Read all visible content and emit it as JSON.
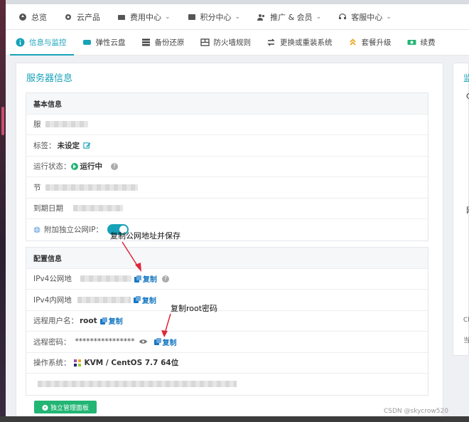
{
  "topnav": {
    "items": [
      {
        "label": "总览",
        "icon": "dashboard-icon",
        "has_dropdown": false
      },
      {
        "label": "云产品",
        "icon": "gear-icon",
        "has_dropdown": false
      },
      {
        "label": "费用中心",
        "icon": "wallet-icon",
        "has_dropdown": true
      },
      {
        "label": "积分中心",
        "icon": "points-icon",
        "has_dropdown": true
      },
      {
        "label": "推广 & 会员",
        "icon": "users-icon",
        "has_dropdown": true
      },
      {
        "label": "客服中心",
        "icon": "headset-icon",
        "has_dropdown": true
      }
    ]
  },
  "tabs": [
    {
      "label": "信息与监控",
      "icon": "info-icon",
      "active": true
    },
    {
      "label": "弹性云盘",
      "icon": "cloud-disk-icon",
      "active": false
    },
    {
      "label": "备份还原",
      "icon": "backup-icon",
      "active": false
    },
    {
      "label": "防火墙规则",
      "icon": "firewall-icon",
      "active": false
    },
    {
      "label": "更换或重装系统",
      "icon": "swap-icon",
      "active": false
    },
    {
      "label": "套餐升级",
      "icon": "upgrade-icon",
      "active": false
    },
    {
      "label": "续费",
      "icon": "renew-icon",
      "active": false
    }
  ],
  "server_panel": {
    "title": "服务器信息",
    "basic": {
      "header": "基本信息",
      "server_label": "服",
      "tag_label": "标签：",
      "tag_value": "未设定",
      "status_label": "运行状态：",
      "status_value": "运行中",
      "node_label": "节",
      "expire_label": "到期日期",
      "public_ip_label": "附加独立公网IP："
    },
    "config": {
      "header": "配置信息",
      "ipv4_public_label": "IPv4公网地",
      "ipv4_private_label": "IPv4内网地",
      "remote_user_label": "远程用户名：",
      "remote_user_value": "root",
      "remote_pass_label": "远程密码：",
      "remote_pass_value": "****************",
      "os_label": "操作系统：",
      "os_value": "KVM / CentOS 7.7 64位",
      "copy_label": "复制"
    },
    "panel_button": "独立管理面板"
  },
  "right_panel": {
    "title": "监",
    "letter1": "C",
    "letter2": "网",
    "letter3": "Cl",
    "letter4": "当"
  },
  "annotations": {
    "public_ip_note": "复制公网地址并保存",
    "root_pass_note": "复制root密码"
  },
  "watermark": "CSDN @skycrow520",
  "colors": {
    "accent": "#17a2b8",
    "link": "#1678c2",
    "success": "#22b573",
    "annotation_arrow": "#e0263a"
  }
}
